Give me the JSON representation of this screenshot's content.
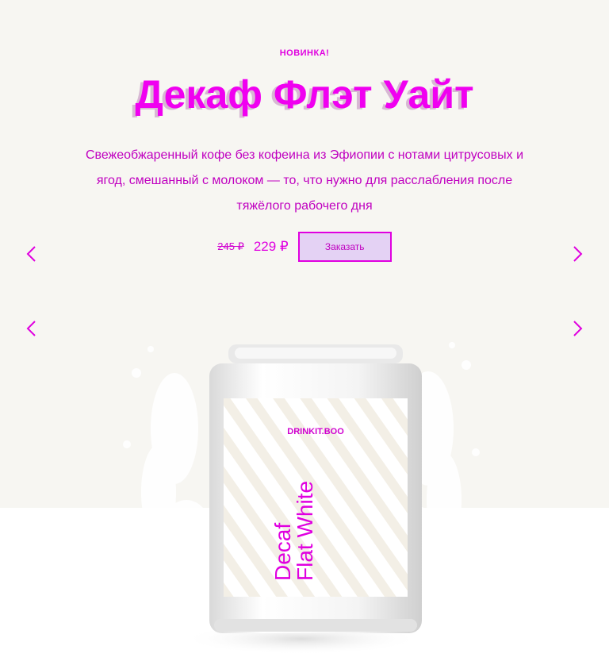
{
  "hero": {
    "badge": "НОВИНКА!",
    "title": "Декаф Флэт Уайт",
    "description": "Свежеобжаренный кофе без кофеина из Эфиопии с нотами цитрусовых и ягод, смешанный с молоком — то, что нужно для расслабления после тяжёлого рабочего дня",
    "old_price": "245 ₽",
    "new_price": "229 ₽",
    "order_label": "Заказать"
  },
  "product": {
    "brand": "DRINKIT.BOO",
    "can_text_line1": "Decaf",
    "can_text_line2": "Flat White"
  },
  "colors": {
    "accent": "#e000e0",
    "hero_background": "#f7f6f2",
    "button_background": "#e4d2f4"
  },
  "icons": {
    "prev": "chevron-left-icon",
    "next": "chevron-right-icon"
  }
}
